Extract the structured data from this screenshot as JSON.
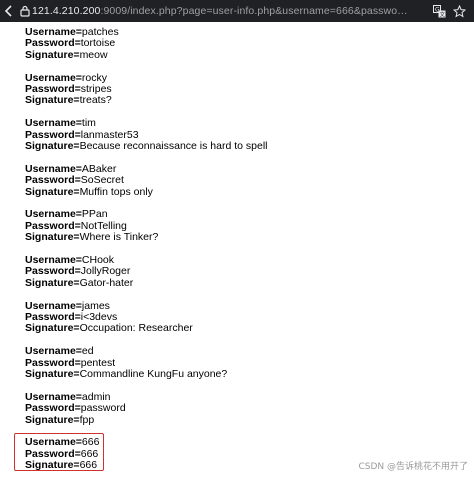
{
  "browser": {
    "url_host": "121.4.210.200",
    "url_path": ":9009/index.php?page=user-info.php&username=666&passwo",
    "url_ellipsis": "…"
  },
  "labels": {
    "username": "Username=",
    "password": "Password=",
    "signature": "Signature="
  },
  "records": [
    {
      "username": "patches",
      "password": "tortoise",
      "signature": "meow"
    },
    {
      "username": "rocky",
      "password": "stripes",
      "signature": "treats?"
    },
    {
      "username": "tim",
      "password": "lanmaster53",
      "signature": "Because reconnaissance is hard to spell"
    },
    {
      "username": "ABaker",
      "password": "SoSecret",
      "signature": "Muffin tops only"
    },
    {
      "username": "PPan",
      "password": "NotTelling",
      "signature": "Where is Tinker?"
    },
    {
      "username": "CHook",
      "password": "JollyRoger",
      "signature": "Gator-hater"
    },
    {
      "username": "james",
      "password": "i<3devs",
      "signature": "Occupation: Researcher"
    },
    {
      "username": "ed",
      "password": "pentest",
      "signature": "Commandline KungFu anyone?"
    },
    {
      "username": "admin",
      "password": "password",
      "signature": "fpp"
    },
    {
      "username": "666",
      "password": "666",
      "signature": "666"
    }
  ],
  "watermark": "CSDN @告诉桃花不用开了",
  "colors": {
    "highlight_box": "#d0312d",
    "toolbar_bg": "#202124"
  },
  "icons": [
    "back-icon",
    "lock-icon",
    "translate-icon",
    "bookmark-star-icon"
  ]
}
